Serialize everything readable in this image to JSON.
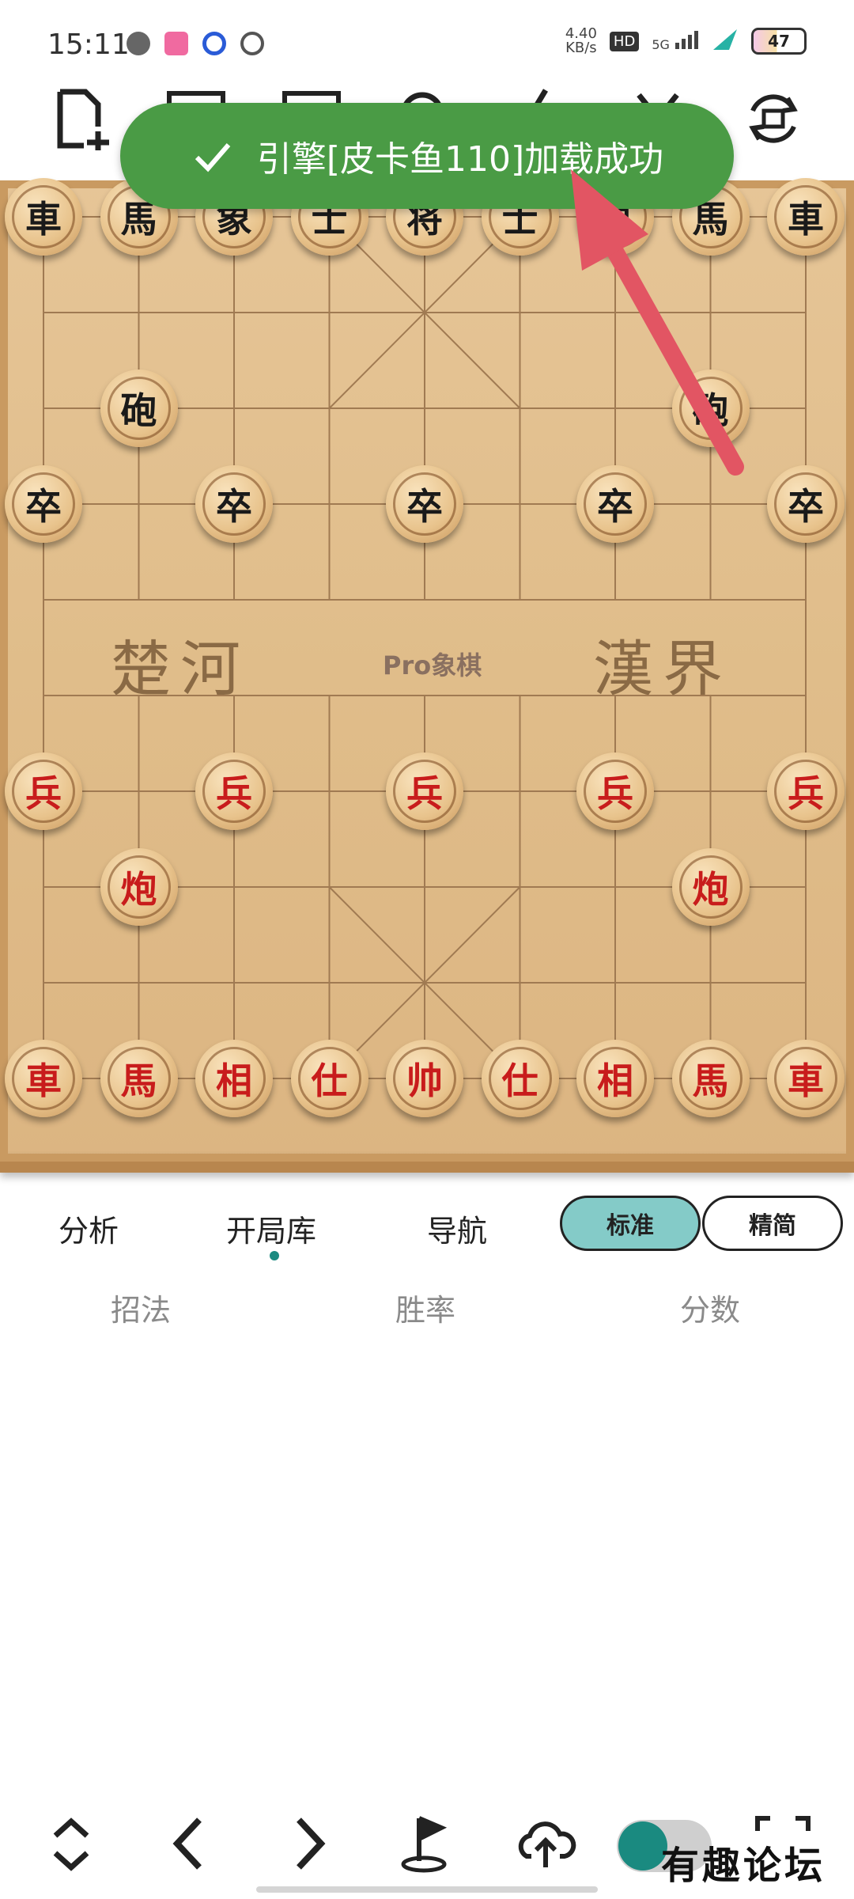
{
  "status_bar": {
    "time": "15:11",
    "net_speed_value": "4.40",
    "net_speed_unit": "KB/s",
    "hd_label": "HD",
    "signal_label": "5G",
    "battery": "47"
  },
  "toast": {
    "message": "引擎[皮卡鱼110]加载成功"
  },
  "board": {
    "river_left": "楚河",
    "river_right": "漢界",
    "brand": "Pro象棋",
    "pieces": {
      "b_r1": "車",
      "b_h1": "馬",
      "b_e1": "象",
      "b_a1": "士",
      "b_k": "将",
      "b_a2": "士",
      "b_e2": "象",
      "b_h2": "馬",
      "b_r2": "車",
      "b_c1": "砲",
      "b_c2": "砲",
      "b_p1": "卒",
      "b_p2": "卒",
      "b_p3": "卒",
      "b_p4": "卒",
      "b_p5": "卒",
      "r_p1": "兵",
      "r_p2": "兵",
      "r_p3": "兵",
      "r_p4": "兵",
      "r_p5": "兵",
      "r_c1": "炮",
      "r_c2": "炮",
      "r_r1": "車",
      "r_h1": "馬",
      "r_e1": "相",
      "r_a1": "仕",
      "r_k": "帅",
      "r_a2": "仕",
      "r_e2": "相",
      "r_h2": "馬",
      "r_r2": "車"
    }
  },
  "tabs": {
    "analysis": "分析",
    "opening_book": "开局库",
    "navigation": "导航",
    "mode_standard": "标准",
    "mode_simple": "精简"
  },
  "columns": {
    "move": "招法",
    "win_rate": "胜率",
    "score": "分数"
  },
  "watermark": "有趣论坛"
}
